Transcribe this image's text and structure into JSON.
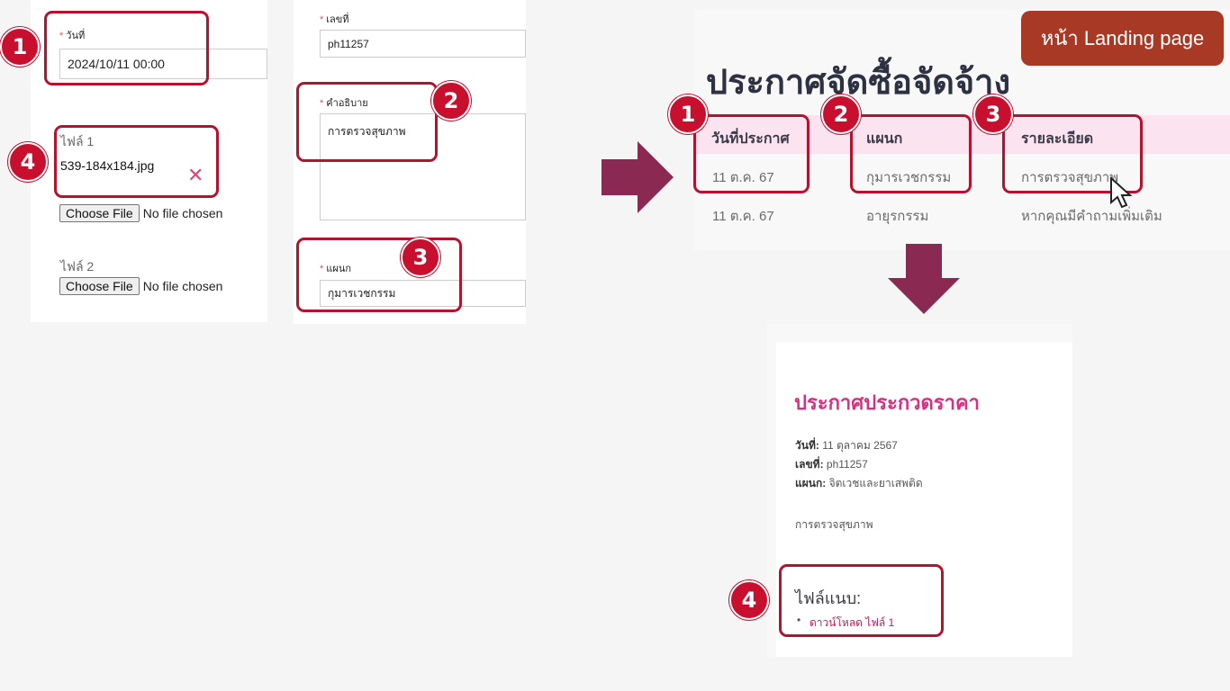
{
  "form_left": {
    "date_label": "วันที่",
    "date_value": "2024/10/11 00:00",
    "file1_label": "ไฟล์ 1",
    "file1_name": "539-184x184.jpg",
    "file2_label": "ไฟล์ 2",
    "choose_file": "Choose File",
    "no_file": "No file chosen"
  },
  "form_right": {
    "number_label": "เลขที่",
    "number_value": "ph11257",
    "desc_label": "คำอธิบาย",
    "desc_value": "การตรวจสุขภาพ",
    "dept_label": "แผนก",
    "dept_value": "กุมารเวชกรรม"
  },
  "badges": [
    "1",
    "2",
    "3",
    "4"
  ],
  "landing_button": "หน้า Landing page",
  "listing": {
    "title": "ประกาศจัดซื้อจัดจ้าง",
    "headers": [
      "วันที่ประกาศ",
      "แผนก",
      "รายละเอียด"
    ],
    "rows": [
      [
        "11 ต.ค. 67",
        "กุมารเวชกรรม",
        "การตรวจสุขภาพ"
      ],
      [
        "11 ต.ค. 67",
        "อายุรกรรม",
        "หากคุณมีคำถามเพิ่มเติม"
      ]
    ]
  },
  "detail": {
    "title": "ประกาศประกวดราคา",
    "date_label": "วันที่:",
    "date_value": "11 ตุลาคม 2567",
    "number_label": "เลขที่:",
    "number_value": "ph11257",
    "dept_label": "แผนก:",
    "dept_value": "จิตเวชและยาเสพติด",
    "description": "การตรวจสุขภาพ",
    "attach_heading": "ไฟล์แนบ:",
    "attach_link": "ดาวน์โหลด ไฟล์ 1"
  },
  "colors": {
    "badge": "#c8102e",
    "box": "#b5122e",
    "arrow": "#8a2a52",
    "landing_bg": "#a83a25",
    "detail_title": "#d6307f",
    "header_bg": "#fbe4ef"
  }
}
